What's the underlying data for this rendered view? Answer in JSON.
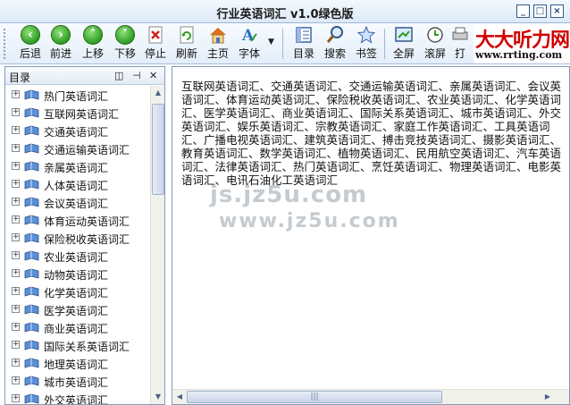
{
  "window": {
    "title": "行业英语词汇 v1.0绿色版",
    "min_label": "_",
    "max_label": "□",
    "close_label": "×"
  },
  "toolbar": {
    "buttons": [
      {
        "label": "后退",
        "icon": "back-arrow-icon"
      },
      {
        "label": "前进",
        "icon": "forward-arrow-icon"
      },
      {
        "label": "上移",
        "icon": "up-arrow-icon"
      },
      {
        "label": "下移",
        "icon": "down-arrow-icon"
      },
      {
        "label": "停止",
        "icon": "stop-icon"
      },
      {
        "label": "刷新",
        "icon": "refresh-icon"
      },
      {
        "label": "主页",
        "icon": "home-icon"
      },
      {
        "label": "字体",
        "icon": "font-icon"
      },
      {
        "label": "目录",
        "icon": "contents-icon"
      },
      {
        "label": "搜索",
        "icon": "search-icon"
      },
      {
        "label": "书签",
        "icon": "bookmark-icon"
      },
      {
        "label": "全屏",
        "icon": "fullscreen-icon"
      },
      {
        "label": "滚屏",
        "icon": "autoscroll-icon"
      },
      {
        "label": "打",
        "icon": "print-icon"
      }
    ]
  },
  "logo": {
    "line1": "大大听力网",
    "line2": "www.rrting.com"
  },
  "sidebar": {
    "title": "目录",
    "items": [
      "热门英语词汇",
      "互联网英语词汇",
      "交通英语词汇",
      "交通运输英语词汇",
      "亲属英语词汇",
      "人体英语词汇",
      "会议英语词汇",
      "体育运动英语词汇",
      "保险税收英语词汇",
      "农业英语词汇",
      "动物英语词汇",
      "化学英语词汇",
      "医学英语词汇",
      "商业英语词汇",
      "国际关系英语词汇",
      "地理英语词汇",
      "城市英语词汇",
      "外交英语词汇"
    ]
  },
  "content": {
    "text": "互联网英语词汇、交通英语词汇、交通运输英语词汇、亲属英语词汇、会议英语词汇、体育运动英语词汇、保险税收英语词汇、农业英语词汇、化学英语词汇、医学英语词汇、商业英语词汇、国际关系英语词汇、城市英语词汇、外交英语词汇、娱乐英语词汇、宗教英语词汇、家庭工作英语词汇、工具英语词汇、广播电视英语词汇、建筑英语词汇、搏击竞技英语词汇、摄影英语词汇、教育英语词汇、数学英语词汇、植物英语词汇、民用航空英语词汇、汽车英语词汇、法律英语词汇、热门英语词汇、烹饪英语词汇、物理英语词汇、电影英语词汇、电讯石油化工英语词汇",
    "watermark1": "js.jz5u.com",
    "watermark2": "www.jz5u.com"
  },
  "colors": {
    "accent_green": "#2e9d23",
    "border": "#7f9db9",
    "logo_red": "#d00000"
  }
}
